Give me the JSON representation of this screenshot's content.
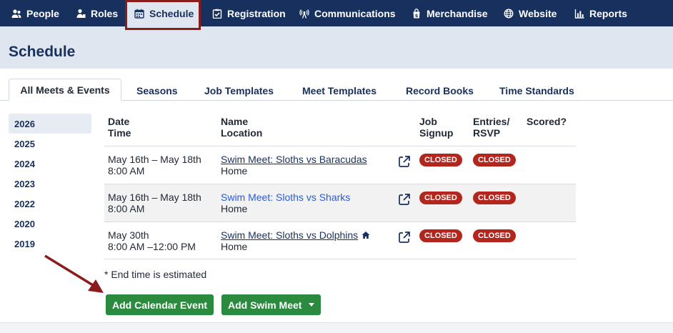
{
  "nav": {
    "items": [
      {
        "label": "People",
        "icon": "people-icon"
      },
      {
        "label": "Roles",
        "icon": "roles-icon"
      },
      {
        "label": "Schedule",
        "icon": "calendar-icon"
      },
      {
        "label": "Registration",
        "icon": "clipboard-check-icon"
      },
      {
        "label": "Communications",
        "icon": "broadcast-icon"
      },
      {
        "label": "Merchandise",
        "icon": "shopping-bag-icon"
      },
      {
        "label": "Website",
        "icon": "globe-icon"
      },
      {
        "label": "Reports",
        "icon": "bar-chart-icon"
      }
    ],
    "active": "Schedule",
    "bg_color": "#17305e"
  },
  "page": {
    "title": "Schedule"
  },
  "tabs": [
    "All Meets & Events",
    "Seasons",
    "Job Templates",
    "Meet Templates",
    "Record Books",
    "Time Standards"
  ],
  "years": [
    "2026",
    "2025",
    "2024",
    "2023",
    "2022",
    "2020",
    "2019"
  ],
  "table": {
    "headers": {
      "date": "Date",
      "time": "Time",
      "name": "Name",
      "location": "Location",
      "job1": "Job",
      "job2": "Signup",
      "entries1": "Entries/",
      "entries2": "RSVP",
      "scored": "Scored?"
    },
    "rows": [
      {
        "date": "May 16th – May 18th",
        "time": "8:00 AM",
        "name": "Swim Meet: Sloths vs Baracudas",
        "location": "Home",
        "job_signup": "CLOSED",
        "entries": "CLOSED"
      },
      {
        "date": "May 16th – May 18th",
        "time": "8:00 AM",
        "name": "Swim Meet: Sloths vs Sharks",
        "location": "Home",
        "job_signup": "CLOSED",
        "entries": "CLOSED"
      },
      {
        "date": "May 30th",
        "time": "8:00 AM –12:00 PM",
        "name": "Swim Meet: Sloths vs Dolphins",
        "location": "Home",
        "job_signup": "CLOSED",
        "entries": "CLOSED"
      }
    ]
  },
  "note": "* End time is estimated",
  "buttons": {
    "add_event": "Add Calendar Event",
    "add_meet": "Add Swim Meet"
  },
  "colors": {
    "primary": "#17305e",
    "success": "#2a8a3e",
    "badge": "#b3261e",
    "annotation": "#8a1c1c"
  }
}
